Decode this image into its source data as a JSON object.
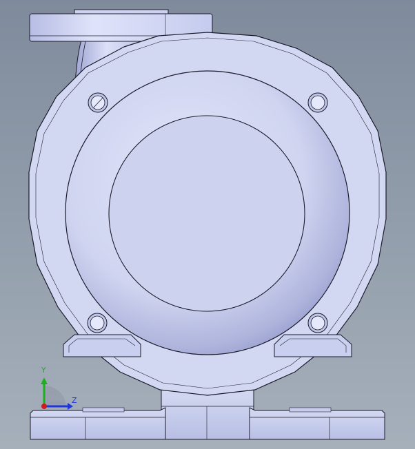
{
  "viewport": {
    "background_top": "#7f8b9c",
    "background_bottom": "#a3adb8",
    "part_fill": "#d6dcf2",
    "part_shade": "#aab2dc",
    "edge_color": "#1a1a2a"
  },
  "triad": {
    "y_label": "Y",
    "z_label": "Z",
    "y_color": "#1fae1f",
    "z_color": "#2136d8",
    "x_color": "#d01c1c"
  }
}
